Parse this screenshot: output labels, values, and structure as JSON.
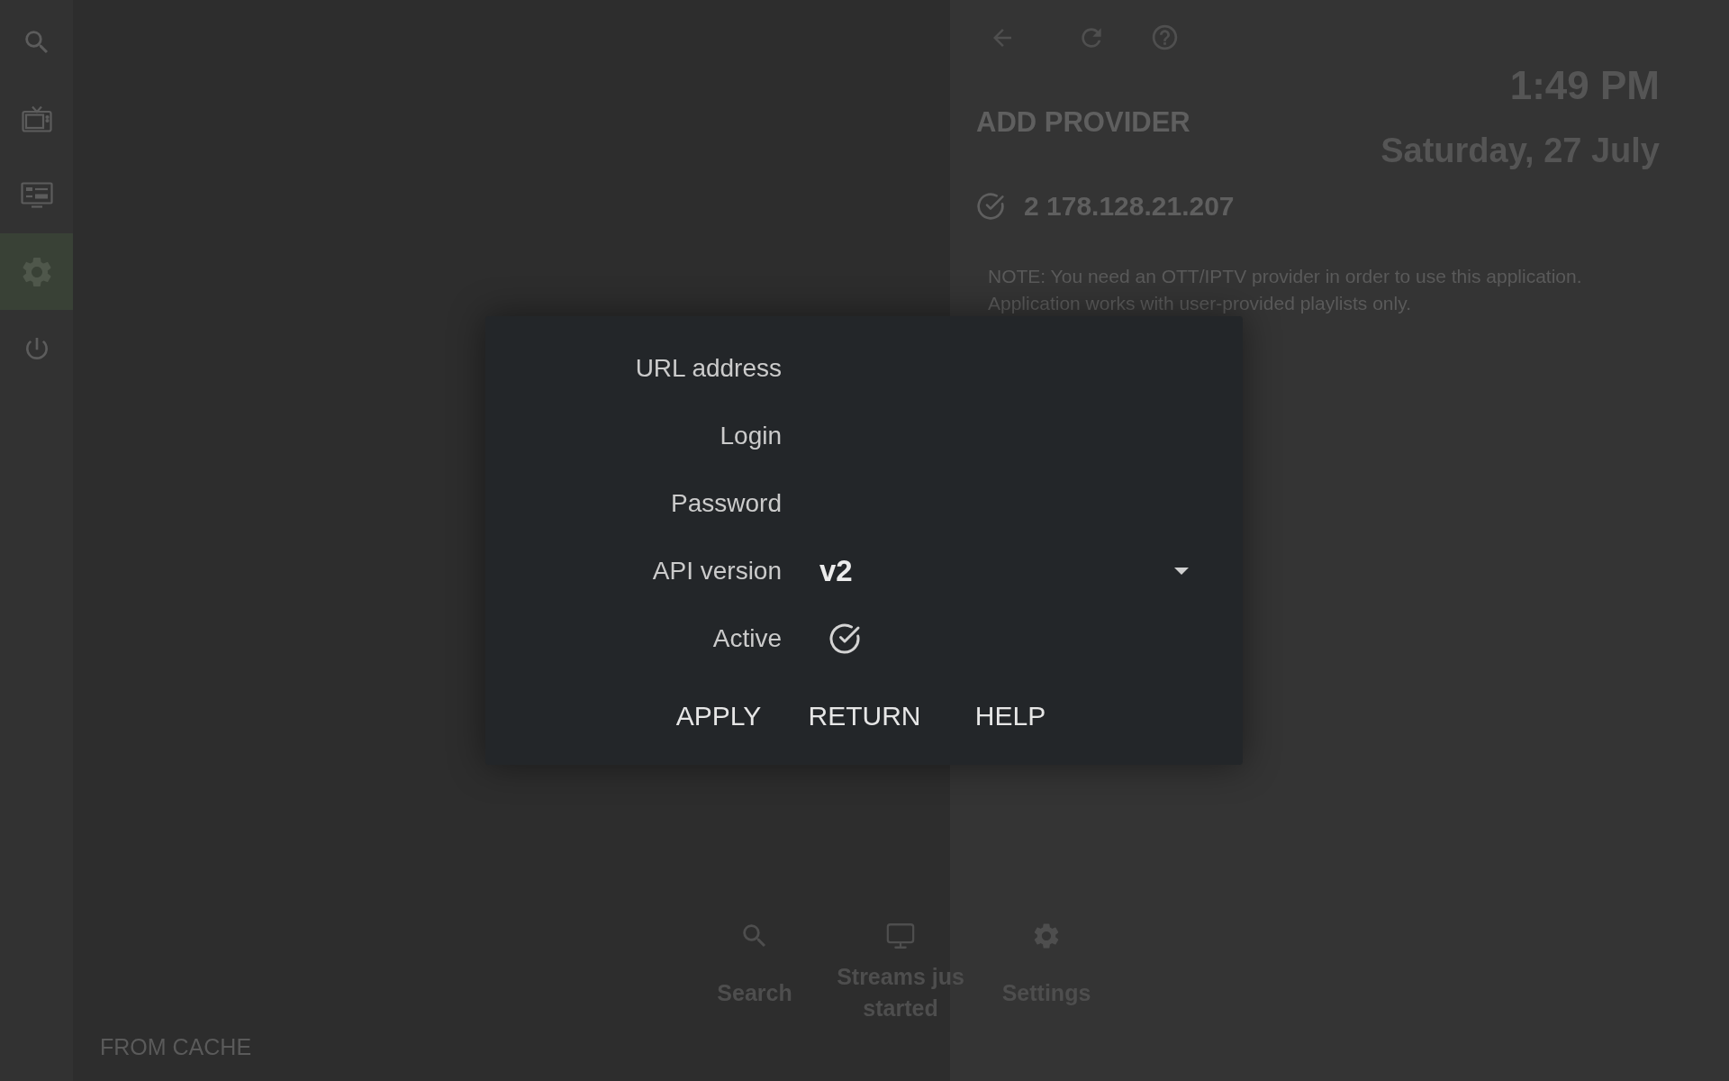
{
  "sidebar": {
    "items": [
      {
        "selected": false
      },
      {
        "selected": false
      },
      {
        "selected": false
      },
      {
        "selected": true
      },
      {
        "selected": false
      }
    ]
  },
  "bottom_nav": {
    "items": [
      {
        "lines": [
          "Search"
        ]
      },
      {
        "lines": [
          "Streams jus",
          "started"
        ]
      },
      {
        "lines": [
          "Settings"
        ]
      }
    ]
  },
  "status_text": "FROM CACHE",
  "panel": {
    "clock": {
      "time": "1:49 PM",
      "date": "Saturday, 27 July"
    },
    "title": "ADD PROVIDER",
    "providers": [
      {
        "active": true,
        "name": "2 178.128.21.207"
      }
    ],
    "note": "NOTE: You need an OTT/IPTV provider in order to use this application. Application works with user-provided playlists only."
  },
  "dialog": {
    "fields": [
      {
        "kind": "text",
        "label": "URL address"
      },
      {
        "kind": "text",
        "label": "Login"
      },
      {
        "kind": "text",
        "label": "Password"
      },
      {
        "kind": "select",
        "label": "API version",
        "value": "v2"
      },
      {
        "kind": "checkbox",
        "label": "Active",
        "checked": true
      }
    ],
    "buttons": [
      "APPLY",
      "RETURN",
      "HELP"
    ]
  }
}
